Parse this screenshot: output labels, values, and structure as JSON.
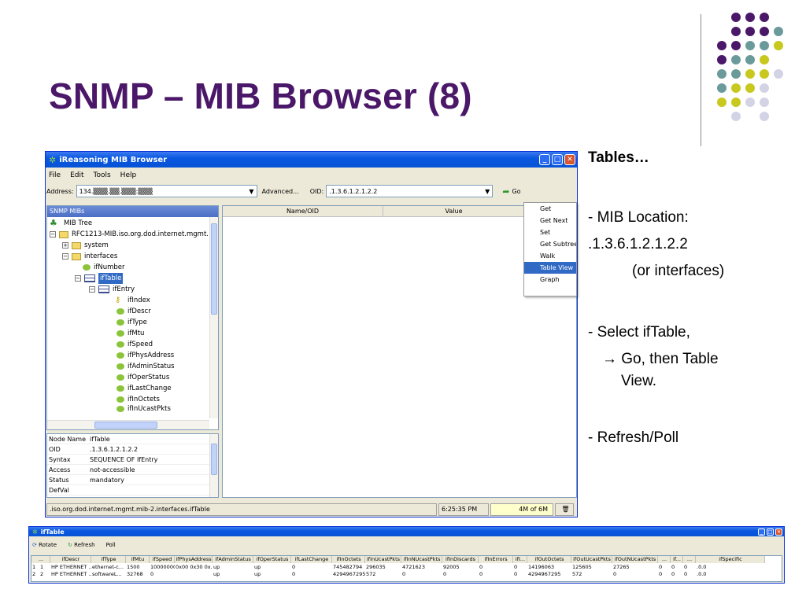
{
  "slide": {
    "title": "SNMP – MIB Browser (8)",
    "dot_colors": {
      "purple": "#4b1869",
      "teal": "#6b9a9a",
      "yellow": "#c8c81e",
      "lavender": "#d3d3e6"
    }
  },
  "notes": {
    "heading": "Tables…",
    "line1": "- MIB Location:",
    "line2": ".1.3.6.1.2.1.2.2",
    "line3": "(or interfaces)",
    "line4": "- Select ifTable,",
    "line5": "→ Go, then Table",
    "line6": "View.",
    "line7": "- Refresh/Poll"
  },
  "app": {
    "title": "iReasoning MIB Browser",
    "menu": [
      "File",
      "Edit",
      "Tools",
      "Help"
    ],
    "address_label": "Address:",
    "address_value": "134.▒▒▒.▒▒.▒▒▒:▒▒▒",
    "advanced_label": "Advanced...",
    "oid_label": "OID:",
    "oid_value": ".1.3.6.1.2.1.2.2",
    "go_label": "Go",
    "left_pane_title": "SNMP MIBs",
    "tree": [
      {
        "label": "MIB Tree"
      },
      {
        "label": "RFC1213-MIB.iso.org.dod.internet.mgmt."
      },
      {
        "label": "system"
      },
      {
        "label": "interfaces"
      },
      {
        "label": "ifNumber"
      },
      {
        "label": "ifTable"
      },
      {
        "label": "ifEntry"
      },
      {
        "label": "ifIndex"
      },
      {
        "label": "ifDescr"
      },
      {
        "label": "ifType"
      },
      {
        "label": "ifMtu"
      },
      {
        "label": "ifSpeed"
      },
      {
        "label": "ifPhysAddress"
      },
      {
        "label": "ifAdminStatus"
      },
      {
        "label": "ifOperStatus"
      },
      {
        "label": "ifLastChange"
      },
      {
        "label": "ifInOctets"
      },
      {
        "label": "ifInUcastPkts"
      }
    ],
    "info": [
      {
        "k": "Node Name",
        "v": "ifTable"
      },
      {
        "k": "OID",
        "v": ".1.3.6.1.2.1.2.2"
      },
      {
        "k": "Syntax",
        "v": "SEQUENCE OF IfEntry"
      },
      {
        "k": "Access",
        "v": "not-accessible"
      },
      {
        "k": "Status",
        "v": "mandatory"
      },
      {
        "k": "DefVal",
        "v": ""
      }
    ],
    "result_headers": [
      "Name/OID",
      "Value"
    ],
    "operations": [
      "Get",
      "Get Next",
      "Set",
      "Get Subtree",
      "Walk",
      "Table View",
      "Graph"
    ],
    "status_path": ".iso.org.dod.internet.mgmt.mib-2.interfaces.ifTable",
    "status_time": "6:25:35 PM",
    "status_mem": "4M of 6M"
  },
  "iftable": {
    "title": "ifTable",
    "toolbar": [
      "Rotate",
      "Refresh",
      "Poll"
    ],
    "headers": [
      "...",
      "ifDescr",
      "ifType",
      "ifMtu",
      "ifSpeed",
      "ifPhysAddress",
      "ifAdminStatus",
      "ifOperStatus",
      "ifLastChange",
      "ifInOctets",
      "ifInUcastPkts",
      "ifInNUcastPkts",
      "ifInDiscards",
      "ifInErrors",
      "ifI...",
      "ifOutOctets",
      "ifOutUcastPkts",
      "ifOutNUcastPkts",
      "...",
      "if...",
      "...",
      "ifSpecific"
    ],
    "rows": [
      [
        "1",
        "1",
        "HP ETHERNET ...",
        "ethernet-c...",
        "1500",
        "10000000",
        "0x00 0x30 0x...",
        "up",
        "up",
        "0",
        "745482794",
        "296035",
        "4721623",
        "92005",
        "0",
        "0",
        "14196063",
        "125605",
        "27265",
        "0",
        "0",
        "0",
        ".0.0"
      ],
      [
        "2",
        "2",
        "HP ETHERNET ...",
        "softwareL...",
        "32768",
        "0",
        "",
        "up",
        "up",
        "0",
        "4294967295",
        "572",
        "0",
        "0",
        "0",
        "0",
        "4294967295",
        "572",
        "0",
        "0",
        "0",
        "0",
        ".0.0"
      ]
    ]
  }
}
